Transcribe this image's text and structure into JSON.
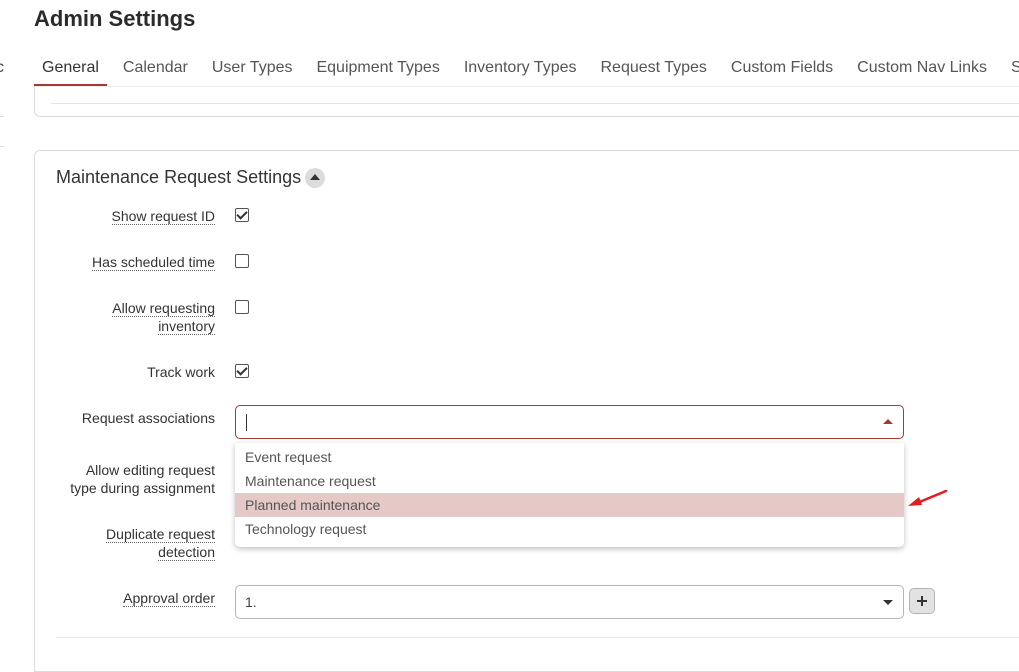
{
  "header": {
    "title": "Admin Settings",
    "left_edge_char": "c"
  },
  "tabs": [
    {
      "label": "General"
    },
    {
      "label": "Calendar"
    },
    {
      "label": "User Types"
    },
    {
      "label": "Equipment Types"
    },
    {
      "label": "Inventory Types"
    },
    {
      "label": "Request Types"
    },
    {
      "label": "Custom Fields"
    },
    {
      "label": "Custom Nav Links"
    },
    {
      "label": "Sec"
    }
  ],
  "section": {
    "title": "Maintenance Request Settings",
    "show_request_id": {
      "label": "Show request ID",
      "checked": true
    },
    "has_scheduled_time": {
      "label": "Has scheduled time",
      "checked": false
    },
    "allow_requesting_inventory": {
      "label_line1": "Allow requesting",
      "label_line2": "inventory",
      "checked": false
    },
    "track_work": {
      "label": "Track work",
      "checked": true
    },
    "request_associations": {
      "label": "Request associations",
      "options": [
        "Event request",
        "Maintenance request",
        "Planned maintenance",
        "Technology request"
      ],
      "highlighted": "Planned maintenance"
    },
    "allow_editing": {
      "label_line1": "Allow editing request",
      "label_line2": "type during assignment"
    },
    "duplicate_detection": {
      "label_line1": "Duplicate request",
      "label_line2": "detection"
    },
    "approval_order": {
      "label": "Approval order",
      "value": "1."
    }
  },
  "colors": {
    "accent": "#a63a32",
    "highlight": "#e4c9c6",
    "arrow": "#e01e1e"
  }
}
